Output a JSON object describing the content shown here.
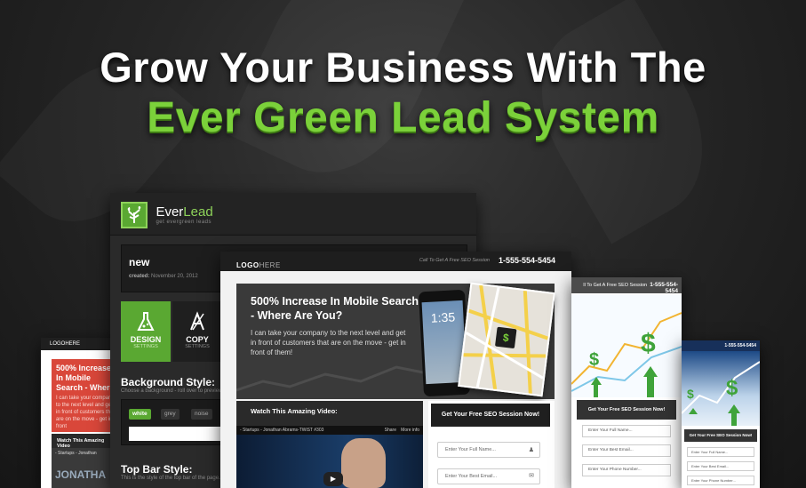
{
  "headline": {
    "line1": "Grow Your Business With The",
    "line2": "Ever Green Lead System"
  },
  "left_mock": {
    "logo": "LOGOHERE",
    "title": "500% Increase In Mobile Search - Where",
    "body": "I can take your company to the next level and get in front of customers that are on the move - get in front",
    "video_title": "Watch This Amazing Video",
    "video_sub": "- Startups - Jonathan",
    "video_overlay": "JONATHA"
  },
  "app": {
    "brand_a": "Ever",
    "brand_b": "Lead",
    "tagline": "get evergreen leads",
    "card_title": "new",
    "card_created_label": "created:",
    "card_created_date": "November 20, 2012",
    "tab_design": "DESIGN",
    "tab_design_sub": "SETTINGS",
    "tab_copy": "COPY",
    "tab_copy_sub": "SETTINGS",
    "bg_style_title": "Background Style:",
    "bg_style_sub": "Choose a background - roll over to preview c",
    "chip_white": "white",
    "chip_grey": "grey",
    "chip_noise": "noise",
    "topbar_title": "Top Bar Style:",
    "topbar_sub": "This is the style of the top bar of the page. Sel"
  },
  "main": {
    "logo_a": "LOGO",
    "logo_b": "HERE",
    "cta": "Call To Get A Free SEO Session",
    "phone": "1-555-554-5454",
    "hero_title": "500% Increase In Mobile Search - Where Are You?",
    "hero_body": "I can take your company to the next level and get in front of customers that are on the move - get in front of them!",
    "phone_time": "1:35",
    "video_heading": "Watch This Amazing Video:",
    "video_bar": "- Startups - Jonathan Abrams-TWiST #303",
    "video_share": "Share",
    "video_info": "More info",
    "form_heading": "Get Your Free SEO Session Now!",
    "field_name": "Enter Your Full Name...",
    "field_email": "Enter Your Best Email..."
  },
  "right1": {
    "cta": "ll To Get A Free SEO Session",
    "phone": "1-555-554-5454",
    "form_heading": "Get Your Free SEO Session Now!",
    "field_name": "Enter Your Full Name...",
    "field_email": "Enter Your Best Email...",
    "field_phone": "Enter Your Phone Number..."
  },
  "right2": {
    "phone": "1-555-554-5454",
    "form_heading": "Get Your Free SEO Session Now!",
    "field_name": "Enter Your Full Name...",
    "field_email": "Enter Your Best Email...",
    "field_phone": "Enter Your Phone Number..."
  }
}
